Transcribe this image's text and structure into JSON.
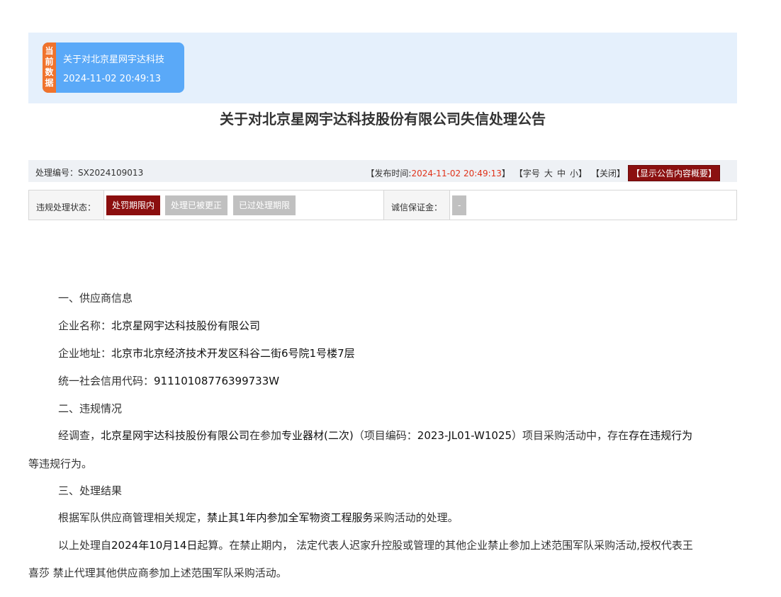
{
  "banner": {
    "tag": "当前数据",
    "card_title": "关于对北京星网宇达科技",
    "card_time": "2024-11-02 20:49:13"
  },
  "page_title": "关于对北京星网宇达科技股份有限公司失信处理公告",
  "infobar": {
    "serial_label": "处理编号：",
    "serial_value": "SX2024109013",
    "publish_label": "【发布时间: ",
    "publish_time": "2024-11-02 20:49:13",
    "publish_end": "】",
    "font_label": "【字号",
    "font_large": "大",
    "font_medium": "中",
    "font_small": "小】",
    "close_label": "【关闭】",
    "summary_label": "【显示公告内容概要】"
  },
  "status": {
    "violation_label": "违规处理状态：",
    "options": [
      "处罚期限内",
      "处理已被更正",
      "已过处理期限"
    ],
    "deposit_label": "诚信保证金：",
    "deposit_value": "-"
  },
  "content": {
    "section1": "一、供应商信息",
    "company_label": "企业名称：",
    "company_name": "北京星网宇达科技股份有限公司",
    "address_label": "企业地址：",
    "address": "北京市北京经济技术开发区科谷二街6号院1号楼7层",
    "credit_label": "统一社会信用代码：",
    "credit_code": "91110108776399733W",
    "section2": "二、违规情况",
    "v_prefix": "经调查，",
    "v_company": "北京星网宇达科技股份有限公司",
    "v_mid": "在参加",
    "v_project": "专业器材(二次)",
    "v_code_label": "（项目编码：",
    "v_code": "2023-JL01-W1025",
    "v_code_end": "）项目采购活动中，存在",
    "v_behavior": "存在违规行为",
    "v_line2": "等违规行为。",
    "section3": "三、处理结果",
    "r_prefix": "根据军队供应商管理相关规定，",
    "r_bold": "禁止其1年内参加全军物资工程服务",
    "r_suffix": "采购活动的处理。",
    "d_prefix": "以上处理自",
    "d_date": "2024年10月14日",
    "d_mid": "起算。在禁止期内， 法定代表人迟家升控股或管理的其他企业禁止参加上述范围军队采购活动,授权代表王",
    "d_line2": "喜莎 禁止代理其他供应商参加上述范围军队采购活动。"
  }
}
